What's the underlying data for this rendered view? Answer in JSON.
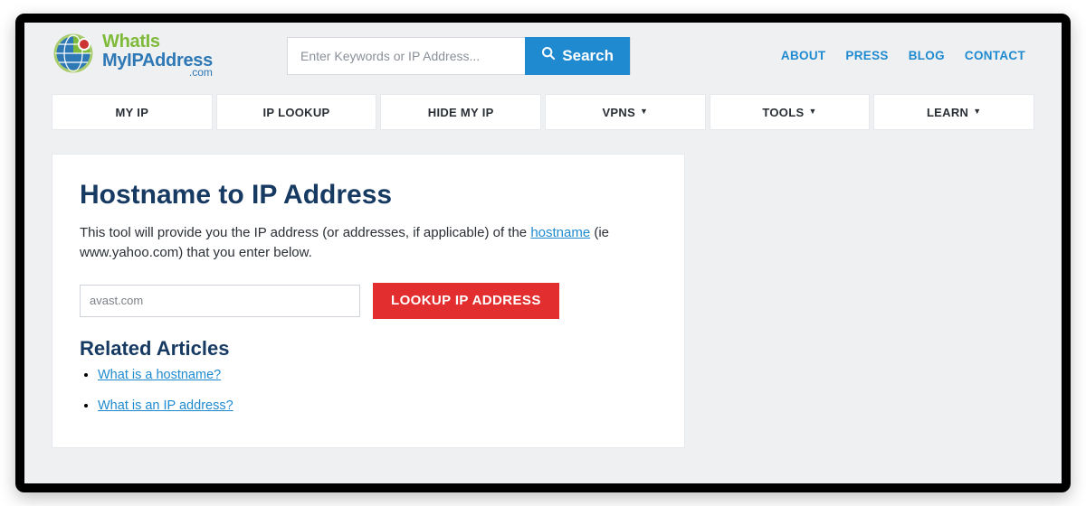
{
  "logo": {
    "line1": "WhatIs",
    "line2": "MyIPAddress",
    "suffix": ".com"
  },
  "search": {
    "placeholder": "Enter Keywords or IP Address...",
    "button": "Search"
  },
  "topnav": [
    {
      "label": "ABOUT"
    },
    {
      "label": "PRESS"
    },
    {
      "label": "BLOG"
    },
    {
      "label": "CONTACT"
    }
  ],
  "mainnav": [
    {
      "label": "MY IP",
      "dropdown": false
    },
    {
      "label": "IP LOOKUP",
      "dropdown": false
    },
    {
      "label": "HIDE MY IP",
      "dropdown": false
    },
    {
      "label": "VPNS",
      "dropdown": true
    },
    {
      "label": "TOOLS",
      "dropdown": true
    },
    {
      "label": "LEARN",
      "dropdown": true
    }
  ],
  "page": {
    "title": "Hostname to IP Address",
    "lead_pre": "This tool will provide you the IP address (or addresses, if applicable) of the ",
    "lead_link": "hostname",
    "lead_post": " (ie www.yahoo.com) that you enter below.",
    "hostname_value": "avast.com",
    "lookup_button": "LOOKUP IP ADDRESS",
    "related_heading": "Related Articles",
    "related": [
      {
        "label": "What is a hostname?"
      },
      {
        "label": "What is an IP address?"
      }
    ]
  },
  "colors": {
    "brand_blue": "#1f8ad0",
    "dark_blue": "#173a63",
    "green": "#7fba3a",
    "red": "#e22e2e",
    "page_bg": "#eef0f2"
  }
}
